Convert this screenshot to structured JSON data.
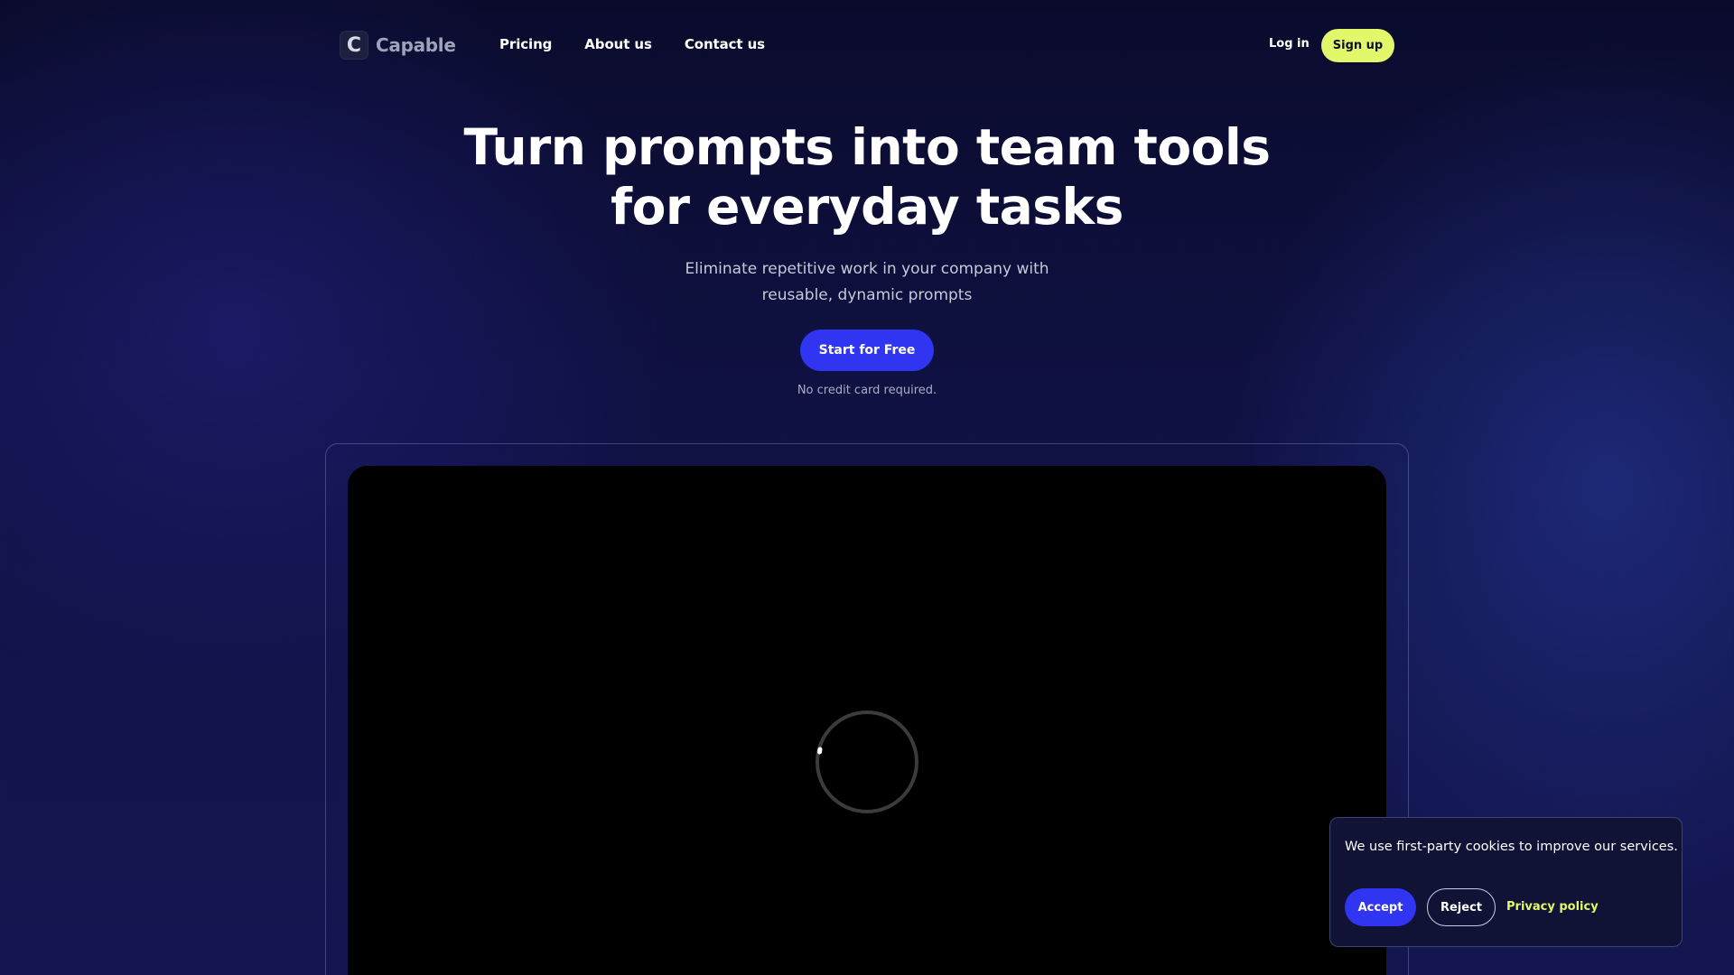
{
  "nav": {
    "logo_letter": "C",
    "brand": "Capable",
    "links": [
      "Pricing",
      "About us",
      "Contact us"
    ],
    "login": "Log in",
    "signup": "Sign up"
  },
  "hero": {
    "title_line1": "Turn prompts into team tools",
    "title_line2": "for everyday tasks",
    "subtitle_line1": "Eliminate repetitive work in your company with",
    "subtitle_line2": "reusable, dynamic prompts",
    "cta": "Start for Free",
    "note": "No credit card required."
  },
  "demo": {
    "loading_icon": "spinner-icon"
  },
  "cookie": {
    "message": "We use first-party cookies to improve our services.",
    "accept": "Accept",
    "reject": "Reject",
    "privacy": "Privacy policy"
  },
  "colors": {
    "accent_blue": "#2f35f0",
    "accent_lime": "#e3f76a",
    "background": "#0f1142"
  }
}
